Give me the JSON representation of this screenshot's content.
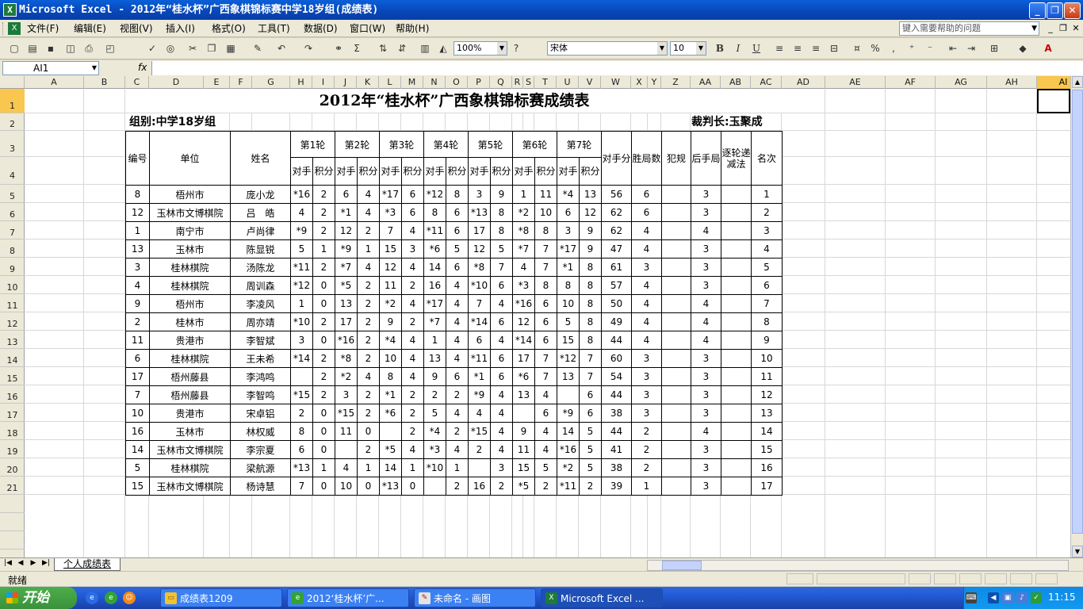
{
  "window": {
    "title": "Microsoft Excel - 2012年“桂水杯”广西象棋锦标赛中学18岁组(成绩表)",
    "min": "_",
    "max": "❐",
    "close": "✕"
  },
  "menu": {
    "items": [
      "文件(F)",
      "编辑(E)",
      "视图(V)",
      "插入(I)",
      "格式(O)",
      "工具(T)",
      "数据(D)",
      "窗口(W)",
      "帮助(H)"
    ],
    "help_placeholder": "键入需要帮助的问题",
    "doc_min": "_",
    "doc_restore": "❐",
    "doc_close": "✕"
  },
  "toolbar": {
    "zoom": "100%",
    "font": "宋体",
    "size": "10",
    "bold": "B",
    "italic": "I",
    "underline": "U",
    "sum": "Σ",
    "percent": "%",
    "comma": ","
  },
  "formula_bar": {
    "cell_ref": "AI1",
    "fx": "fx",
    "value": ""
  },
  "columns": [
    [
      "A",
      31,
      106
    ],
    [
      "B",
      106,
      158
    ],
    [
      "C",
      158,
      188
    ],
    [
      "D",
      188,
      257
    ],
    [
      "E",
      257,
      290
    ],
    [
      "F",
      290,
      318
    ],
    [
      "G",
      318,
      366
    ],
    [
      "H",
      366,
      394
    ],
    [
      "I",
      394,
      422
    ],
    [
      "J",
      422,
      450
    ],
    [
      "K",
      450,
      478
    ],
    [
      "L",
      478,
      506
    ],
    [
      "M",
      506,
      534
    ],
    [
      "N",
      534,
      562
    ],
    [
      "O",
      562,
      590
    ],
    [
      "P",
      590,
      618
    ],
    [
      "Q",
      618,
      646
    ],
    [
      "R",
      646,
      660
    ],
    [
      "S",
      660,
      674
    ],
    [
      "T",
      674,
      702
    ],
    [
      "U",
      702,
      730
    ],
    [
      "V",
      730,
      758
    ],
    [
      "W",
      758,
      796
    ],
    [
      "X",
      796,
      817
    ],
    [
      "Y",
      817,
      834
    ],
    [
      "Z",
      834,
      871
    ],
    [
      "AA",
      871,
      909
    ],
    [
      "AB",
      909,
      947
    ],
    [
      "AC",
      947,
      986
    ],
    [
      "AD",
      986,
      1041
    ],
    [
      "AE",
      1041,
      1117
    ],
    [
      "AF",
      1117,
      1180
    ],
    [
      "AG",
      1180,
      1245
    ],
    [
      "AH",
      1245,
      1308
    ],
    [
      "AI",
      1308,
      1375
    ]
  ],
  "rows": [
    [
      "1",
      16,
      47
    ],
    [
      "2",
      47,
      69
    ],
    [
      "3",
      69,
      102
    ],
    [
      "4",
      102,
      137
    ],
    [
      "5",
      137,
      160
    ],
    [
      "6",
      160,
      183
    ],
    [
      "7",
      183,
      206
    ],
    [
      "8",
      206,
      229
    ],
    [
      "9",
      229,
      252
    ],
    [
      "10",
      252,
      275
    ],
    [
      "11",
      275,
      298
    ],
    [
      "12",
      298,
      321
    ],
    [
      "13",
      321,
      344
    ],
    [
      "14",
      344,
      367
    ],
    [
      "15",
      367,
      390
    ],
    [
      "16",
      390,
      413
    ],
    [
      "17",
      413,
      436
    ],
    [
      "18",
      436,
      459
    ],
    [
      "19",
      459,
      482
    ],
    [
      "20",
      482,
      505
    ],
    [
      "21",
      505,
      528
    ]
  ],
  "sheet": {
    "title": "2012年“桂水杯”广西象棋锦标赛成绩表",
    "group": "组别:中学18岁组",
    "judge": "裁判长:玉聚成",
    "headers": {
      "no": "编号",
      "unit": "单位",
      "name": "姓名",
      "rounds": [
        "第1轮",
        "第2轮",
        "第3轮",
        "第4轮",
        "第5轮",
        "第6轮",
        "第7轮"
      ],
      "opp": "对手",
      "pts": "积分",
      "opp_score": "对手分",
      "wins": "胜局数",
      "foul": "犯规",
      "back": "后手局",
      "elim": "逐轮递减法",
      "rank": "名次"
    },
    "players": [
      [
        "8",
        "梧州市",
        "庞小龙",
        "*16",
        "2",
        "6",
        "4",
        "*17",
        "6",
        "*12",
        "8",
        "3",
        "9",
        "1",
        "11",
        "*4",
        "13",
        "56",
        "6",
        "",
        "3",
        "",
        "1"
      ],
      [
        "12",
        "玉林市文博棋院",
        "吕　皓",
        "4",
        "2",
        "*1",
        "4",
        "*3",
        "6",
        "8",
        "6",
        "*13",
        "8",
        "*2",
        "10",
        "6",
        "12",
        "62",
        "6",
        "",
        "3",
        "",
        "2"
      ],
      [
        "1",
        "南宁市",
        "卢尚律",
        "*9",
        "2",
        "12",
        "2",
        "7",
        "4",
        "*11",
        "6",
        "17",
        "8",
        "*8",
        "8",
        "3",
        "9",
        "62",
        "4",
        "",
        "4",
        "",
        "3"
      ],
      [
        "13",
        "玉林市",
        "陈显锐",
        "5",
        "1",
        "*9",
        "1",
        "15",
        "3",
        "*6",
        "5",
        "12",
        "5",
        "*7",
        "7",
        "*17",
        "9",
        "47",
        "4",
        "",
        "3",
        "",
        "4"
      ],
      [
        "3",
        "桂林棋院",
        "汤陈龙",
        "*11",
        "2",
        "*7",
        "4",
        "12",
        "4",
        "14",
        "6",
        "*8",
        "7",
        "4",
        "7",
        "*1",
        "8",
        "61",
        "3",
        "",
        "3",
        "",
        "5"
      ],
      [
        "4",
        "桂林棋院",
        "周训森",
        "*12",
        "0",
        "*5",
        "2",
        "11",
        "2",
        "16",
        "4",
        "*10",
        "6",
        "*3",
        "8",
        "8",
        "8",
        "57",
        "4",
        "",
        "3",
        "",
        "6"
      ],
      [
        "9",
        "梧州市",
        "李凌风",
        "1",
        "0",
        "13",
        "2",
        "*2",
        "4",
        "*17",
        "4",
        "7",
        "4",
        "*16",
        "6",
        "10",
        "8",
        "50",
        "4",
        "",
        "4",
        "",
        "7"
      ],
      [
        "2",
        "桂林市",
        "周亦靖",
        "*10",
        "2",
        "17",
        "2",
        "9",
        "2",
        "*7",
        "4",
        "*14",
        "6",
        "12",
        "6",
        "5",
        "8",
        "49",
        "4",
        "",
        "4",
        "",
        "8"
      ],
      [
        "11",
        "贵港市",
        "李智斌",
        "3",
        "0",
        "*16",
        "2",
        "*4",
        "4",
        "1",
        "4",
        "6",
        "4",
        "*14",
        "6",
        "15",
        "8",
        "44",
        "4",
        "",
        "4",
        "",
        "9"
      ],
      [
        "6",
        "桂林棋院",
        "王未希",
        "*14",
        "2",
        "*8",
        "2",
        "10",
        "4",
        "13",
        "4",
        "*11",
        "6",
        "17",
        "7",
        "*12",
        "7",
        "60",
        "3",
        "",
        "3",
        "",
        "10"
      ],
      [
        "17",
        "梧州藤县",
        "李鸿鸣",
        "",
        "2",
        "*2",
        "4",
        "8",
        "4",
        "9",
        "6",
        "*1",
        "6",
        "*6",
        "7",
        "13",
        "7",
        "54",
        "3",
        "",
        "3",
        "",
        "11"
      ],
      [
        "7",
        "梧州藤县",
        "李智鸣",
        "*15",
        "2",
        "3",
        "2",
        "*1",
        "2",
        "2",
        "2",
        "*9",
        "4",
        "13",
        "4",
        "",
        "6",
        "44",
        "3",
        "",
        "3",
        "",
        "12"
      ],
      [
        "10",
        "贵港市",
        "宋卓铝",
        "2",
        "0",
        "*15",
        "2",
        "*6",
        "2",
        "5",
        "4",
        "4",
        "4",
        "",
        "6",
        "*9",
        "6",
        "38",
        "3",
        "",
        "3",
        "",
        "13"
      ],
      [
        "16",
        "玉林市",
        "林权威",
        "8",
        "0",
        "11",
        "0",
        "",
        "2",
        "*4",
        "2",
        "*15",
        "4",
        "9",
        "4",
        "14",
        "5",
        "44",
        "2",
        "",
        "4",
        "",
        "14"
      ],
      [
        "14",
        "玉林市文博棋院",
        "李宗夏",
        "6",
        "0",
        "",
        "2",
        "*5",
        "4",
        "*3",
        "4",
        "2",
        "4",
        "11",
        "4",
        "*16",
        "5",
        "41",
        "2",
        "",
        "3",
        "",
        "15"
      ],
      [
        "5",
        "桂林棋院",
        "梁航源",
        "*13",
        "1",
        "4",
        "1",
        "14",
        "1",
        "*10",
        "1",
        "",
        "3",
        "15",
        "5",
        "*2",
        "5",
        "38",
        "2",
        "",
        "3",
        "",
        "16"
      ],
      [
        "15",
        "玉林市文博棋院",
        "杨诗慧",
        "7",
        "0",
        "10",
        "0",
        "*13",
        "0",
        "",
        "2",
        "16",
        "2",
        "*5",
        "2",
        "*11",
        "2",
        "39",
        "1",
        "",
        "3",
        "",
        "17"
      ]
    ]
  },
  "tabs": {
    "sheet": "个人成绩表"
  },
  "status": {
    "text": "就绪"
  },
  "taskbar": {
    "start": "开始",
    "tasks": [
      "成绩表1209",
      "2012‘桂水杯’广...",
      "未命名 - 画图",
      "Microsoft Excel ..."
    ],
    "clock": "11:15"
  }
}
